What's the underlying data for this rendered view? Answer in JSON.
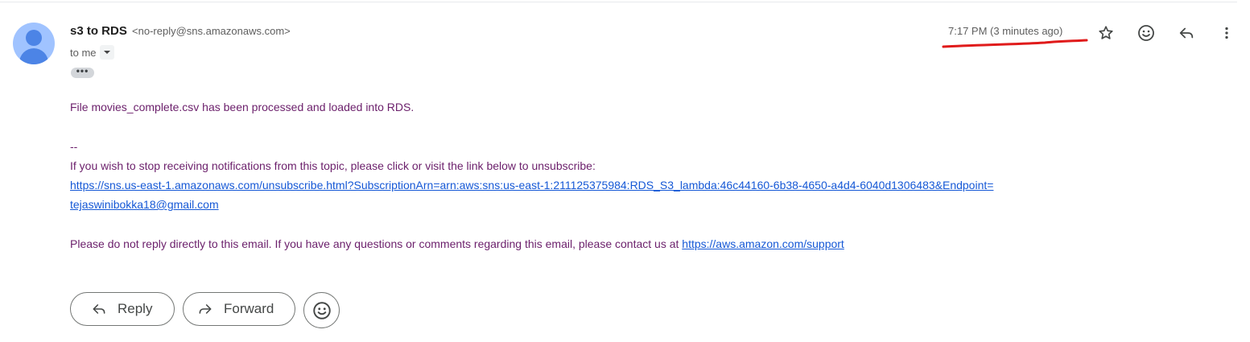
{
  "header": {
    "sender_name": "s3 to RDS",
    "sender_email": "<no-reply@sns.amazonaws.com>",
    "recipient_label": "to me",
    "timestamp": "7:17 PM (3 minutes ago)",
    "icons": {
      "star": "star-icon",
      "emoji": "emoji-icon",
      "reply": "reply-icon",
      "more": "more-vert-icon",
      "caret": "chevron-down-icon",
      "ellipsis": "show-trimmed-content-icon"
    },
    "ellipsis_text": "•••"
  },
  "message": {
    "line1": "File movies_complete.csv has been processed and loaded into RDS.",
    "signature_sep": "--",
    "unsubscribe_intro": "If you wish to stop receiving notifications from this topic, please click or visit the link below to unsubscribe:",
    "unsubscribe_link_part1": "https://sns.us-east-1.amazonaws.com/unsubscribe.html?SubscriptionArn=arn:aws:sns:us-east-1:211125375984:RDS_S3_lambda:46c44160-6b38-4650-a4d4-6040d1306483&Endpoint=",
    "unsubscribe_link_part2": "tejaswinibokka18@gmail.com",
    "noreply_text": "Please do not reply directly to this email. If you have any questions or comments regarding this email, please contact us at ",
    "support_link": "https://aws.amazon.com/support"
  },
  "actions": {
    "reply_label": "Reply",
    "forward_label": "Forward"
  },
  "colors": {
    "body_text": "#6b1f6b",
    "link": "#1558d6",
    "annotation": "#e01b1b",
    "avatar_bg": "#a0c3ff",
    "avatar_fg": "#4c84e6"
  }
}
